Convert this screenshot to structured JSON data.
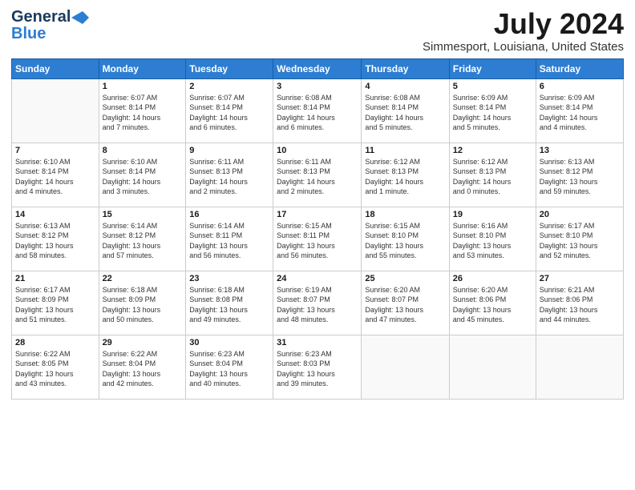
{
  "header": {
    "logo_general": "General",
    "logo_blue": "Blue",
    "month_year": "July 2024",
    "location": "Simmesport, Louisiana, United States"
  },
  "weekdays": [
    "Sunday",
    "Monday",
    "Tuesday",
    "Wednesday",
    "Thursday",
    "Friday",
    "Saturday"
  ],
  "weeks": [
    [
      {
        "day": "",
        "info": ""
      },
      {
        "day": "1",
        "info": "Sunrise: 6:07 AM\nSunset: 8:14 PM\nDaylight: 14 hours\nand 7 minutes."
      },
      {
        "day": "2",
        "info": "Sunrise: 6:07 AM\nSunset: 8:14 PM\nDaylight: 14 hours\nand 6 minutes."
      },
      {
        "day": "3",
        "info": "Sunrise: 6:08 AM\nSunset: 8:14 PM\nDaylight: 14 hours\nand 6 minutes."
      },
      {
        "day": "4",
        "info": "Sunrise: 6:08 AM\nSunset: 8:14 PM\nDaylight: 14 hours\nand 5 minutes."
      },
      {
        "day": "5",
        "info": "Sunrise: 6:09 AM\nSunset: 8:14 PM\nDaylight: 14 hours\nand 5 minutes."
      },
      {
        "day": "6",
        "info": "Sunrise: 6:09 AM\nSunset: 8:14 PM\nDaylight: 14 hours\nand 4 minutes."
      }
    ],
    [
      {
        "day": "7",
        "info": "Sunrise: 6:10 AM\nSunset: 8:14 PM\nDaylight: 14 hours\nand 4 minutes."
      },
      {
        "day": "8",
        "info": "Sunrise: 6:10 AM\nSunset: 8:14 PM\nDaylight: 14 hours\nand 3 minutes."
      },
      {
        "day": "9",
        "info": "Sunrise: 6:11 AM\nSunset: 8:13 PM\nDaylight: 14 hours\nand 2 minutes."
      },
      {
        "day": "10",
        "info": "Sunrise: 6:11 AM\nSunset: 8:13 PM\nDaylight: 14 hours\nand 2 minutes."
      },
      {
        "day": "11",
        "info": "Sunrise: 6:12 AM\nSunset: 8:13 PM\nDaylight: 14 hours\nand 1 minute."
      },
      {
        "day": "12",
        "info": "Sunrise: 6:12 AM\nSunset: 8:13 PM\nDaylight: 14 hours\nand 0 minutes."
      },
      {
        "day": "13",
        "info": "Sunrise: 6:13 AM\nSunset: 8:12 PM\nDaylight: 13 hours\nand 59 minutes."
      }
    ],
    [
      {
        "day": "14",
        "info": "Sunrise: 6:13 AM\nSunset: 8:12 PM\nDaylight: 13 hours\nand 58 minutes."
      },
      {
        "day": "15",
        "info": "Sunrise: 6:14 AM\nSunset: 8:12 PM\nDaylight: 13 hours\nand 57 minutes."
      },
      {
        "day": "16",
        "info": "Sunrise: 6:14 AM\nSunset: 8:11 PM\nDaylight: 13 hours\nand 56 minutes."
      },
      {
        "day": "17",
        "info": "Sunrise: 6:15 AM\nSunset: 8:11 PM\nDaylight: 13 hours\nand 56 minutes."
      },
      {
        "day": "18",
        "info": "Sunrise: 6:15 AM\nSunset: 8:10 PM\nDaylight: 13 hours\nand 55 minutes."
      },
      {
        "day": "19",
        "info": "Sunrise: 6:16 AM\nSunset: 8:10 PM\nDaylight: 13 hours\nand 53 minutes."
      },
      {
        "day": "20",
        "info": "Sunrise: 6:17 AM\nSunset: 8:10 PM\nDaylight: 13 hours\nand 52 minutes."
      }
    ],
    [
      {
        "day": "21",
        "info": "Sunrise: 6:17 AM\nSunset: 8:09 PM\nDaylight: 13 hours\nand 51 minutes."
      },
      {
        "day": "22",
        "info": "Sunrise: 6:18 AM\nSunset: 8:09 PM\nDaylight: 13 hours\nand 50 minutes."
      },
      {
        "day": "23",
        "info": "Sunrise: 6:18 AM\nSunset: 8:08 PM\nDaylight: 13 hours\nand 49 minutes."
      },
      {
        "day": "24",
        "info": "Sunrise: 6:19 AM\nSunset: 8:07 PM\nDaylight: 13 hours\nand 48 minutes."
      },
      {
        "day": "25",
        "info": "Sunrise: 6:20 AM\nSunset: 8:07 PM\nDaylight: 13 hours\nand 47 minutes."
      },
      {
        "day": "26",
        "info": "Sunrise: 6:20 AM\nSunset: 8:06 PM\nDaylight: 13 hours\nand 45 minutes."
      },
      {
        "day": "27",
        "info": "Sunrise: 6:21 AM\nSunset: 8:06 PM\nDaylight: 13 hours\nand 44 minutes."
      }
    ],
    [
      {
        "day": "28",
        "info": "Sunrise: 6:22 AM\nSunset: 8:05 PM\nDaylight: 13 hours\nand 43 minutes."
      },
      {
        "day": "29",
        "info": "Sunrise: 6:22 AM\nSunset: 8:04 PM\nDaylight: 13 hours\nand 42 minutes."
      },
      {
        "day": "30",
        "info": "Sunrise: 6:23 AM\nSunset: 8:04 PM\nDaylight: 13 hours\nand 40 minutes."
      },
      {
        "day": "31",
        "info": "Sunrise: 6:23 AM\nSunset: 8:03 PM\nDaylight: 13 hours\nand 39 minutes."
      },
      {
        "day": "",
        "info": ""
      },
      {
        "day": "",
        "info": ""
      },
      {
        "day": "",
        "info": ""
      }
    ]
  ]
}
